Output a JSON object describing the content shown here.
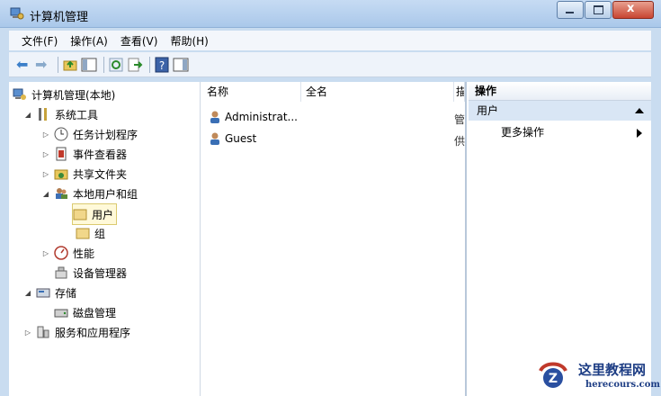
{
  "window": {
    "title": "计算机管理",
    "close_glyph": "x"
  },
  "menu": [
    "文件(F)",
    "操作(A)",
    "查看(V)",
    "帮助(H)"
  ],
  "toolbar": {
    "icons": [
      "back-arrow-icon",
      "forward-arrow-icon",
      "up-folder-icon",
      "show-hide-tree-icon",
      "refresh-icon",
      "export-list-icon",
      "help-icon",
      "show-hide-action-pane-icon"
    ]
  },
  "tree": {
    "root": "计算机管理(本地)",
    "system_tools": "系统工具",
    "task_scheduler": "任务计划程序",
    "event_viewer": "事件查看器",
    "shared_folders": "共享文件夹",
    "local_users_groups": "本地用户和组",
    "users": "用户",
    "groups": "组",
    "performance": "性能",
    "device_manager": "设备管理器",
    "storage": "存储",
    "disk_management": "磁盘管理",
    "services_apps": "服务和应用程序",
    "expand_glyph_open": "◢",
    "expand_glyph_closed": "▷"
  },
  "list": {
    "columns": [
      "名称",
      "全名",
      "描"
    ],
    "rows": [
      {
        "name": "Administrat...",
        "fullname": "",
        "desc": "管"
      },
      {
        "name": "Guest",
        "fullname": "",
        "desc": "供"
      }
    ]
  },
  "actions": {
    "header": "操作",
    "section": "用户",
    "more": "更多操作"
  },
  "watermark": {
    "text": "这里教程网",
    "url": "herecours.com"
  }
}
